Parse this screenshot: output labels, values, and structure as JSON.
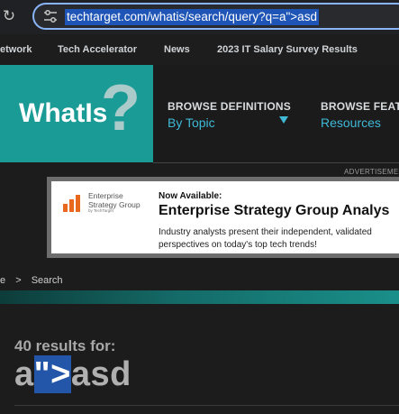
{
  "browser": {
    "url": "techtarget.com/whatis/search/query?q=a\">asd",
    "reload_icon": "reload-icon",
    "site_info_icon": "tune-icon"
  },
  "nav": {
    "items": [
      "etwork",
      "Tech Accelerator",
      "News",
      "2023 IT Salary Survey Results"
    ]
  },
  "header": {
    "logo": "WhatIs",
    "logo_mark": "?",
    "browse_definitions": {
      "label": "BROWSE DEFINITIONS",
      "value": "By Topic"
    },
    "browse_features": {
      "label": "BROWSE FEAT",
      "value": "Resources"
    }
  },
  "ad": {
    "label": "ADVERTISEMEN",
    "brand_line1": "Enterprise",
    "brand_line2": "Strategy Group",
    "brand_by": "by TechTarget",
    "now": "Now Available:",
    "title": "Enterprise Strategy Group Analys",
    "body_line1": "Industry analysts present their independent, validated",
    "body_line2": "perspectives on today's top tech trends!"
  },
  "breadcrumb": {
    "items": [
      "e",
      ">",
      "Search"
    ]
  },
  "results": {
    "count_text": "40 results for:",
    "query_prefix": "a",
    "query_selected": "\">",
    "query_suffix": "asd"
  },
  "colors": {
    "accent_teal": "#1a9b96",
    "link_blue": "#3fb9d6",
    "selection": "#2356a8",
    "focus_ring": "#8ab4f8"
  }
}
